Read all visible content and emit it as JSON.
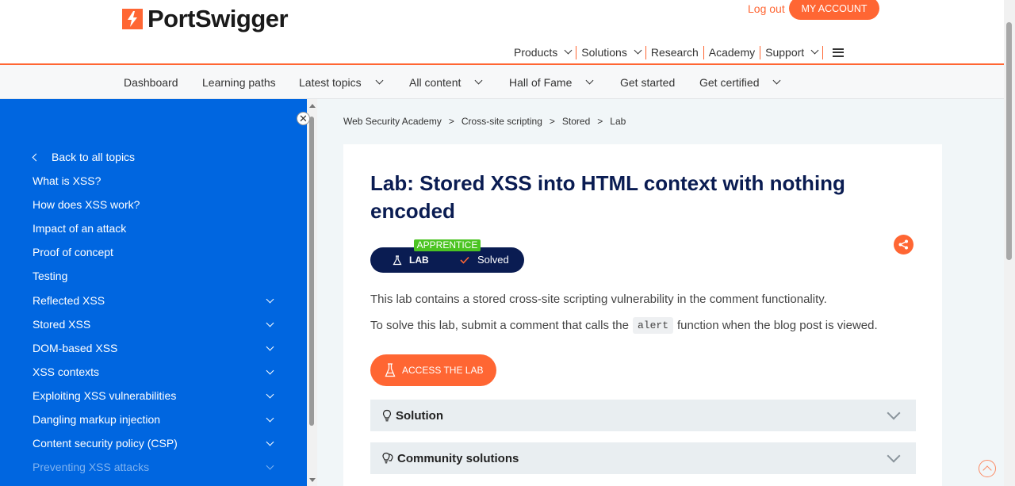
{
  "header": {
    "brand": "PortSwigger",
    "logout": "Log out",
    "my_account": "MY ACCOUNT",
    "nav": [
      {
        "label": "Products",
        "has_menu": true
      },
      {
        "label": "Solutions",
        "has_menu": true
      },
      {
        "label": "Research",
        "has_menu": false
      },
      {
        "label": "Academy",
        "has_menu": false
      },
      {
        "label": "Support",
        "has_menu": true
      }
    ],
    "accent_color": "#ff6633"
  },
  "subnav": [
    {
      "label": "Dashboard",
      "has_menu": false
    },
    {
      "label": "Learning paths",
      "has_menu": false
    },
    {
      "label": "Latest topics",
      "has_menu": true
    },
    {
      "label": "All content",
      "has_menu": true
    },
    {
      "label": "Hall of Fame",
      "has_menu": true
    },
    {
      "label": "Get started",
      "has_menu": false
    },
    {
      "label": "Get certified",
      "has_menu": true
    }
  ],
  "sidebar": {
    "background": "#0066e0",
    "back_label": "Back to all topics",
    "close_glyph": "✕",
    "items": [
      {
        "label": "What is XSS?",
        "expandable": false
      },
      {
        "label": "How does XSS work?",
        "expandable": false
      },
      {
        "label": "Impact of an attack",
        "expandable": false
      },
      {
        "label": "Proof of concept",
        "expandable": false
      },
      {
        "label": "Testing",
        "expandable": false
      },
      {
        "label": "Reflected XSS",
        "expandable": true
      },
      {
        "label": "Stored XSS",
        "expandable": true
      },
      {
        "label": "DOM-based XSS",
        "expandable": true
      },
      {
        "label": "XSS contexts",
        "expandable": true
      },
      {
        "label": "Exploiting XSS vulnerabilities",
        "expandable": true
      },
      {
        "label": "Dangling markup injection",
        "expandable": true
      },
      {
        "label": "Content security policy (CSP)",
        "expandable": true
      },
      {
        "label": "Preventing XSS attacks",
        "expandable": true
      }
    ]
  },
  "breadcrumb": [
    "Web Security Academy",
    "Cross-site scripting",
    "Stored",
    "Lab"
  ],
  "lab": {
    "title": "Lab: Stored XSS into HTML context with nothing encoded",
    "level": "APPRENTICE",
    "type_label": "LAB",
    "status": "Solved",
    "description": "This lab contains a stored cross-site scripting vulnerability in the comment functionality.",
    "instructions_before": "To solve this lab, submit a comment that calls the",
    "instructions_code": "alert",
    "instructions_after": "function when the blog post is viewed.",
    "access_button": "ACCESS THE LAB",
    "accordions": [
      "Solution",
      "Community solutions"
    ]
  }
}
